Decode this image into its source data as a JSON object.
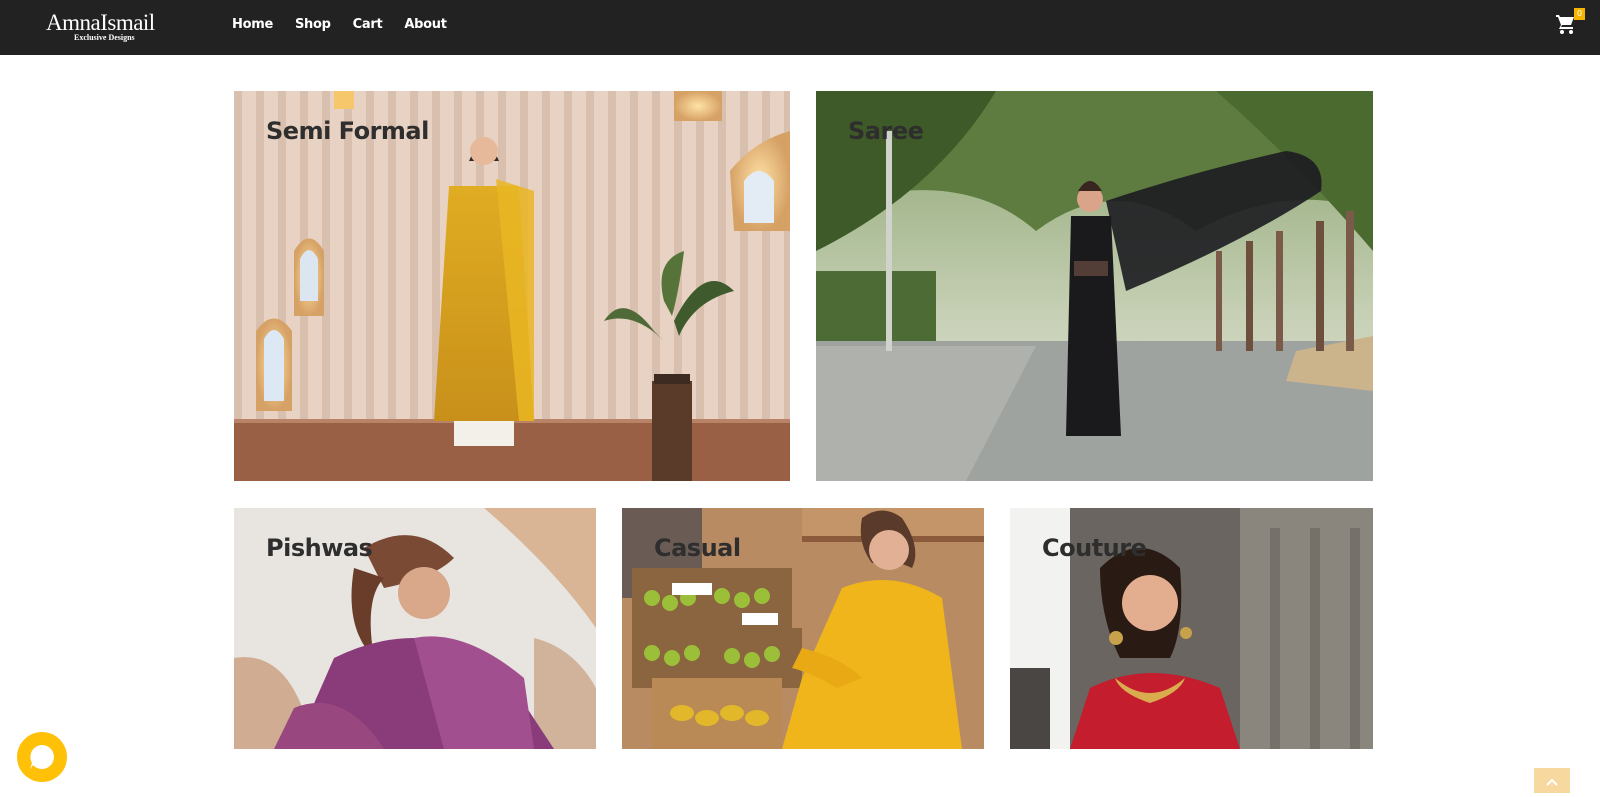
{
  "brand": {
    "name": "AmnaIsmail",
    "tagline": "Exclusive Designs"
  },
  "nav": {
    "items": [
      {
        "label": "Home"
      },
      {
        "label": "Shop"
      },
      {
        "label": "Cart"
      },
      {
        "label": "About"
      }
    ],
    "cart_count": "0"
  },
  "categories": [
    {
      "label": "Semi Formal"
    },
    {
      "label": "Saree"
    },
    {
      "label": "Pishwas"
    },
    {
      "label": "Casual"
    },
    {
      "label": "Couture"
    }
  ],
  "colors": {
    "navbar": "#222222",
    "accent": "#ffc107",
    "badge": "#f4b400",
    "label_text": "#2e2e2e"
  },
  "icons": {
    "cart": "cart-icon",
    "chat": "chat-icon",
    "back_to_top": "chevron-up-icon"
  }
}
